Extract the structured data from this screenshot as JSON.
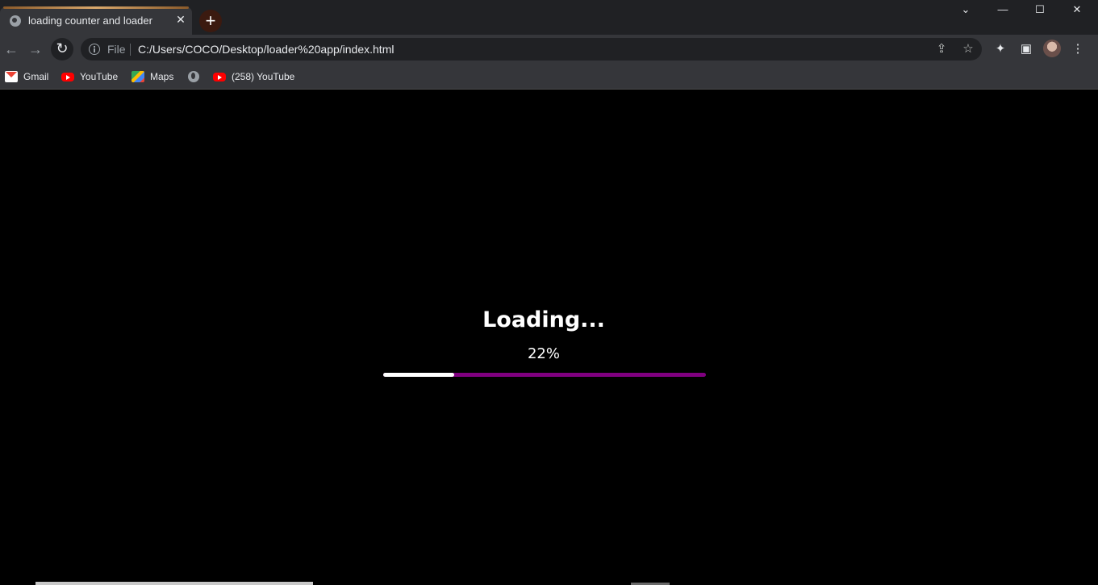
{
  "tab": {
    "title": "loading counter and loader",
    "close": "✕"
  },
  "newtab": "+",
  "window": {
    "minimize": "—",
    "maximize": "☐",
    "close": "✕",
    "tabsearch": "⌄"
  },
  "nav": {
    "back": "←",
    "forward": "→",
    "reload": "↻"
  },
  "omnibox": {
    "scheme": "File",
    "url": "C:/Users/COCO/Desktop/loader%20app/index.html",
    "share": "⇪",
    "star": "☆"
  },
  "toolbar_icons": {
    "extensions": "✦",
    "sidepanel": "▣",
    "menu": "⋮"
  },
  "bookmarks": [
    {
      "label": "Gmail",
      "icon": "gmail-icon"
    },
    {
      "label": "YouTube",
      "icon": "youtube-icon"
    },
    {
      "label": "Maps",
      "icon": "maps-icon"
    },
    {
      "label": "",
      "icon": "globe-icon"
    },
    {
      "label": "(258) YouTube",
      "icon": "youtube-icon"
    }
  ],
  "page": {
    "heading": "Loading...",
    "percent_text": "22%",
    "progress": 0.22,
    "colors": {
      "track": "#800080",
      "fill": "#ffffff",
      "background": "#000000"
    }
  }
}
